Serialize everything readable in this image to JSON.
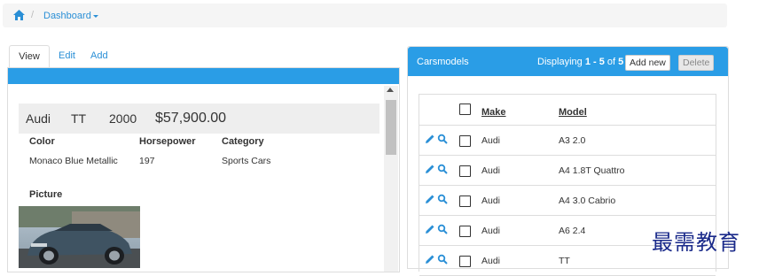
{
  "breadcrumb": {
    "current": "Dashboard"
  },
  "left": {
    "tabs": [
      "View",
      "Edit",
      "Add"
    ],
    "record": {
      "make": "Audi",
      "model": "TT",
      "year": "2000",
      "price": "$57,900.00"
    },
    "fields": {
      "color_label": "Color",
      "color_value": "Monaco Blue Metallic",
      "hp_label": "Horsepower",
      "hp_value": "197",
      "category_label": "Category",
      "category_value": "Sports Cars",
      "picture_label": "Picture"
    }
  },
  "right": {
    "title": "Carsmodels",
    "display": {
      "prefix": "Displaying ",
      "range": "1 - 5",
      "of": " of ",
      "total": "5"
    },
    "add_label": "Add new",
    "delete_label": "Delete",
    "columns": {
      "make": "Make",
      "model": "Model"
    },
    "rows": [
      {
        "make": "Audi",
        "model": "A3 2.0"
      },
      {
        "make": "Audi",
        "model": "A4 1.8T Quattro"
      },
      {
        "make": "Audi",
        "model": "A4 3.0 Cabrio"
      },
      {
        "make": "Audi",
        "model": "A6 2.4"
      },
      {
        "make": "Audi",
        "model": "TT"
      }
    ]
  },
  "watermark": "最需教育",
  "colors": {
    "accent": "#2a9de6",
    "link": "#2a8fd6"
  }
}
